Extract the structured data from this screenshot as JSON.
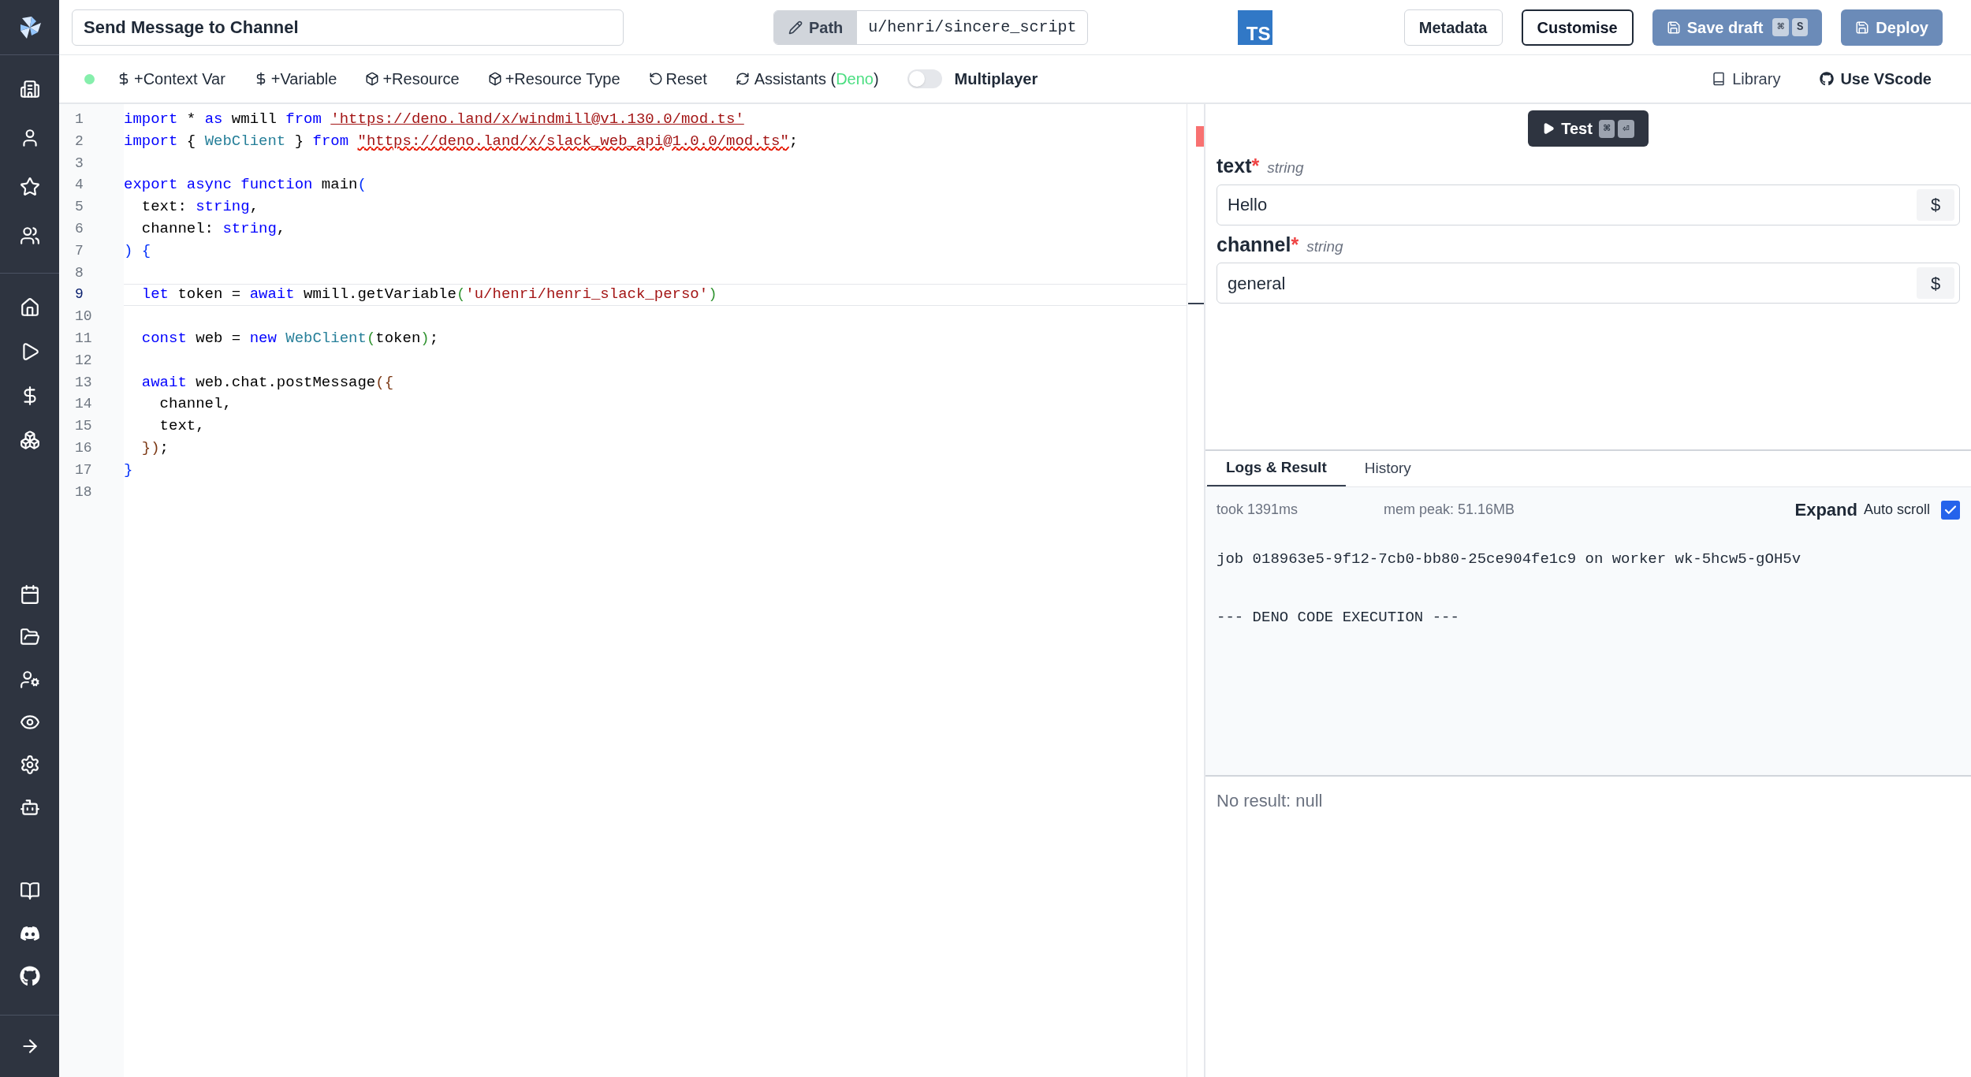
{
  "header": {
    "title_value": "Send Message to Channel",
    "path_button": "Path",
    "path_value": "u/henri/sincere_script",
    "language_badge": "TS",
    "buttons": [
      {
        "label": "Metadata",
        "kind": "plain"
      },
      {
        "label": "Customise",
        "kind": "outline"
      },
      {
        "label": "Save draft",
        "kind": "primary",
        "keys": [
          "⌘",
          "S"
        ]
      },
      {
        "label": "Deploy",
        "kind": "primary"
      }
    ]
  },
  "toolbar": {
    "connected": true,
    "items": [
      {
        "label": "+Context Var",
        "kind": "dollar"
      },
      {
        "label": "+Variable",
        "kind": "dollar"
      },
      {
        "label": "+Resource",
        "kind": "cube"
      },
      {
        "label": "+Resource Type",
        "kind": "cube"
      },
      {
        "label": "Reset",
        "kind": "undo"
      }
    ],
    "assistants": {
      "prefix": "Assistants (",
      "lang": "Deno",
      "suffix": ")"
    },
    "multiplayer": {
      "label": "Multiplayer",
      "on": false
    },
    "right_items": [
      {
        "label": "Library",
        "kind": "book"
      },
      {
        "label": "Use VScode",
        "kind": "github"
      }
    ]
  },
  "editor": {
    "lines": [
      {
        "number": "1",
        "current": false,
        "tokens": [
          {
            "text": "import",
            "kind": "keyword"
          },
          {
            "text": " * ",
            "kind": "plain"
          },
          {
            "text": "as",
            "kind": "keyword"
          },
          {
            "text": " wmill ",
            "kind": "plain"
          },
          {
            "text": "from ",
            "kind": "keyword"
          },
          {
            "text": "'https://deno.land/x/windmill@v1.130.0/mod.ts'",
            "kind": "link"
          }
        ]
      },
      {
        "number": "2",
        "current": false,
        "tokens": [
          {
            "text": "import",
            "kind": "keyword"
          },
          {
            "text": " { ",
            "kind": "plain"
          },
          {
            "text": "WebClient",
            "kind": "class"
          },
          {
            "text": " } ",
            "kind": "plain"
          },
          {
            "text": "from ",
            "kind": "keyword"
          },
          {
            "text": "\"https://deno.land/x/slack_web_api@1.0.0/mod.ts\"",
            "kind": "error"
          },
          {
            "text": ";",
            "kind": "plain"
          }
        ]
      },
      {
        "number": "3",
        "current": false
      },
      {
        "number": "4",
        "current": false,
        "tokens": [
          {
            "text": "export async function",
            "kind": "keyword"
          },
          {
            "text": " main",
            "kind": "plain"
          },
          {
            "text": "(",
            "kind": "bracket1"
          }
        ]
      },
      {
        "number": "5",
        "current": false,
        "tokens": [
          {
            "text": "  text: ",
            "kind": "plain"
          },
          {
            "text": "string",
            "kind": "keyword"
          },
          {
            "text": ",",
            "kind": "plain"
          }
        ]
      },
      {
        "number": "6",
        "current": false,
        "tokens": [
          {
            "text": "  channel: ",
            "kind": "plain"
          },
          {
            "text": "string",
            "kind": "keyword"
          },
          {
            "text": ",",
            "kind": "plain"
          }
        ]
      },
      {
        "number": "7",
        "current": false,
        "tokens": [
          {
            "text": ") {",
            "kind": "bracket1"
          }
        ]
      },
      {
        "number": "8",
        "current": false
      },
      {
        "number": "9",
        "current": true,
        "tokens": [
          {
            "text": "  let",
            "kind": "keyword"
          },
          {
            "text": " token = ",
            "kind": "plain"
          },
          {
            "text": "await",
            "kind": "keyword"
          },
          {
            "text": " wmill.getVariable",
            "kind": "plain"
          },
          {
            "text": "(",
            "kind": "bracket2"
          },
          {
            "text": "'u/henri/henri_slack_perso'",
            "kind": "string"
          },
          {
            "text": ")",
            "kind": "bracket2"
          }
        ]
      },
      {
        "number": "10",
        "current": false
      },
      {
        "number": "11",
        "current": false,
        "tokens": [
          {
            "text": "  const",
            "kind": "keyword"
          },
          {
            "text": " web = ",
            "kind": "plain"
          },
          {
            "text": "new ",
            "kind": "keyword"
          },
          {
            "text": "WebClient",
            "kind": "class"
          },
          {
            "text": "(",
            "kind": "bracket2"
          },
          {
            "text": "token",
            "kind": "plain"
          },
          {
            "text": ")",
            "kind": "bracket2"
          },
          {
            "text": ";",
            "kind": "plain"
          }
        ]
      },
      {
        "number": "12",
        "current": false
      },
      {
        "number": "13",
        "current": false,
        "tokens": [
          {
            "text": "  await",
            "kind": "keyword"
          },
          {
            "text": " web.chat.postMessage",
            "kind": "plain"
          },
          {
            "text": "({",
            "kind": "bracket3"
          }
        ]
      },
      {
        "number": "14",
        "current": false,
        "tokens": [
          {
            "text": "    channel,",
            "kind": "plain"
          }
        ]
      },
      {
        "number": "15",
        "current": false,
        "tokens": [
          {
            "text": "    text,",
            "kind": "plain"
          }
        ]
      },
      {
        "number": "16",
        "current": false,
        "tokens": [
          {
            "text": "  })",
            "kind": "bracket3"
          },
          {
            "text": ";",
            "kind": "plain"
          }
        ]
      },
      {
        "number": "17",
        "current": false,
        "tokens": [
          {
            "text": "}",
            "kind": "bracket1"
          }
        ]
      },
      {
        "number": "18",
        "current": false
      }
    ]
  },
  "test_button": {
    "label": "Test",
    "keys": [
      "⌘",
      "⏎"
    ]
  },
  "args": [
    {
      "name": "text",
      "required": true,
      "mark": "*",
      "type": "string",
      "value": "Hello",
      "dollar": "$"
    },
    {
      "name": "channel",
      "required": true,
      "mark": "*",
      "type": "string",
      "value": "general",
      "dollar": "$"
    }
  ],
  "logs": {
    "tabs": [
      {
        "label": "Logs & Result",
        "selected": true
      },
      {
        "label": "History",
        "selected": false
      }
    ],
    "took": "took 1391ms",
    "mem_peak": "mem peak: 51.16MB",
    "expand": "Expand",
    "auto_scroll": {
      "label": "Auto scroll",
      "checked": true
    },
    "lines": [
      "job 018963e5-9f12-7cb0-bb80-25ce904fe1c9 on worker wk-5hcw5-gOH5v",
      "--- DENO CODE EXECUTION ---"
    ],
    "result": "No result: null"
  }
}
